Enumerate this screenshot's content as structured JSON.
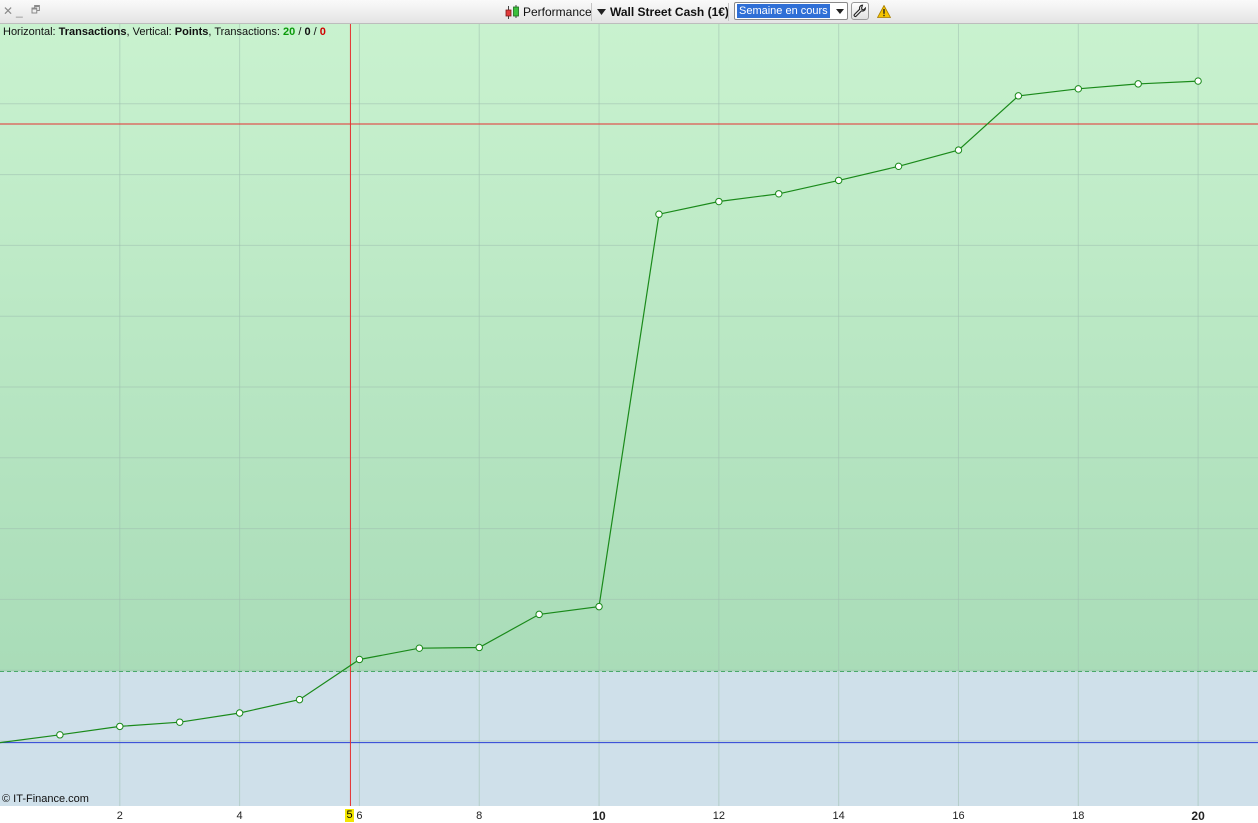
{
  "window_controls": {
    "close": "✕",
    "minimize": "_",
    "restore": "🗗"
  },
  "toolbar": {
    "performance_label": "Performance",
    "instrument_label": "Wall Street Cash (1€)",
    "period_value": "Semaine en cours"
  },
  "info": {
    "horizontal_prefix": "Horizontal: ",
    "horizontal_value": "Transactions",
    "vertical_prefix": ", Vertical: ",
    "vertical_value": "Points",
    "transactions_prefix": ", Transactions: ",
    "tx_won": "20",
    "tx_sep1": " / ",
    "tx_neutral": "0",
    "tx_sep2": " / ",
    "tx_lost": "0"
  },
  "copyright": "© IT-Finance.com",
  "colors": {
    "line": "#1a8a1a",
    "win_bg_top": "#c9f2cf",
    "win_bg_bottom": "#a9dcb8",
    "loss_bg": "#cfe0ea",
    "crosshair": "#e53030",
    "zero_line": "#2a3fd6",
    "tx_won": "#0a9a0a",
    "tx_lost": "#d00000"
  },
  "chart_data": {
    "type": "line",
    "x": [
      0,
      1,
      2,
      3,
      4,
      5,
      6,
      7,
      8,
      9,
      10,
      11,
      12,
      13,
      14,
      15,
      16,
      17,
      18,
      19,
      20
    ],
    "y": [
      0,
      0.11,
      0.23,
      0.29,
      0.42,
      0.61,
      1.18,
      1.34,
      1.35,
      1.82,
      1.93,
      7.5,
      7.68,
      7.79,
      7.98,
      8.18,
      8.41,
      9.18,
      9.28,
      9.35,
      9.39
    ],
    "xlim": [
      0,
      21
    ],
    "ylim": [
      -0.9,
      10.2
    ],
    "x_ticks": [
      2,
      4,
      6,
      8,
      10,
      12,
      14,
      16,
      18,
      20
    ],
    "x_major_ticks": [
      10,
      20
    ],
    "cursor_x_label": "5",
    "cursor_x": 5.85,
    "cursor_y": 8.78,
    "grid": true
  }
}
